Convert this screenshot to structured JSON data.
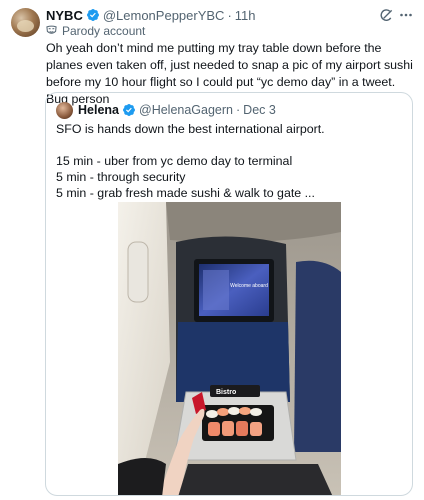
{
  "tweet": {
    "author_name": "NYBC",
    "author_handle": "@LemonPepperYBC",
    "separator": "·",
    "time": "11h",
    "parody_label": "Parody account",
    "text": "Oh yeah don’t mind me putting my tray table down before the planes even taken off, just needed to snap a pic of my airport sushi before my 10 hour flight so I could put “yc demo day” in a tweet. Bug person"
  },
  "quote": {
    "author_name": "Helena",
    "author_handle": "@HelenaGagern",
    "separator": "·",
    "time": "Dec 3",
    "lines": [
      "SFO is hands down the best international airport.",
      "",
      "15 min - uber from yc demo day to terminal",
      "5 min - through security",
      "5 min - grab fresh made sushi & walk to gate ..."
    ],
    "photo": {
      "screen_welcome": "Welcome aboard",
      "bag_label": "Bistro"
    }
  },
  "icons": {
    "verified": "verified-badge-icon",
    "parody": "parody-mask-icon",
    "grok": "grok-icon",
    "more": "more-icon"
  },
  "colors": {
    "verified_blue": "#1d9bf0",
    "secondary_text": "#536471",
    "border": "#cfd9de"
  }
}
